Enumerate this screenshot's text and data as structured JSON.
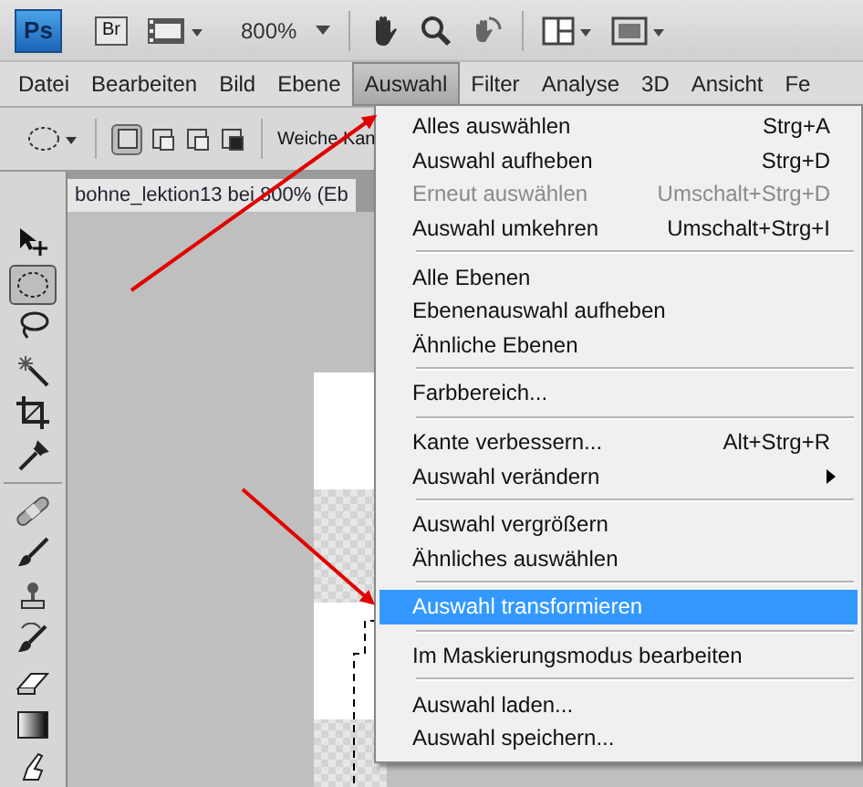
{
  "app_bar": {
    "logo": "Ps",
    "bridge": "Br",
    "zoom": "800%"
  },
  "menu_bar": [
    {
      "label": "Datei",
      "selected": false
    },
    {
      "label": "Bearbeiten",
      "selected": false
    },
    {
      "label": "Bild",
      "selected": false
    },
    {
      "label": "Ebene",
      "selected": false
    },
    {
      "label": "Auswahl",
      "selected": true
    },
    {
      "label": "Filter",
      "selected": false
    },
    {
      "label": "Analyse",
      "selected": false
    },
    {
      "label": "3D",
      "selected": false
    },
    {
      "label": "Ansicht",
      "selected": false
    },
    {
      "label": "Fe",
      "selected": false
    }
  ],
  "options_bar": {
    "modes": [
      {
        "selected": true
      },
      {
        "selected": false
      },
      {
        "selected": false
      },
      {
        "selected": false
      }
    ],
    "feather_label": "Weiche Kan"
  },
  "tools": [
    {
      "kind": "move",
      "selected": false
    },
    {
      "kind": "ellipse",
      "selected": true
    },
    {
      "kind": "lasso",
      "selected": false
    },
    {
      "kind": "wand",
      "selected": false
    },
    {
      "kind": "crop",
      "selected": false
    },
    {
      "kind": "eyedropper",
      "selected": false
    },
    {
      "kind": "separator"
    },
    {
      "kind": "healing",
      "selected": false
    },
    {
      "kind": "brush",
      "selected": false
    },
    {
      "kind": "stamp",
      "selected": false
    },
    {
      "kind": "history",
      "selected": false
    },
    {
      "kind": "eraser",
      "selected": false
    },
    {
      "kind": "gradient",
      "selected": false
    },
    {
      "kind": "finger",
      "selected": false
    }
  ],
  "document_tab": {
    "title": "bohne_lektion13 bei 800% (Eb"
  },
  "menu": [
    {
      "kind": "item",
      "label": "Alles auswählen",
      "shortcut": "Strg+A",
      "disabled": false,
      "selected": false,
      "submenu": false
    },
    {
      "kind": "item",
      "label": "Auswahl aufheben",
      "shortcut": "Strg+D",
      "disabled": false,
      "selected": false,
      "submenu": false
    },
    {
      "kind": "item",
      "label": "Erneut auswählen",
      "shortcut": "Umschalt+Strg+D",
      "disabled": true,
      "selected": false,
      "submenu": false
    },
    {
      "kind": "item",
      "label": "Auswahl umkehren",
      "shortcut": "Umschalt+Strg+I",
      "disabled": false,
      "selected": false,
      "submenu": false
    },
    {
      "kind": "separator"
    },
    {
      "kind": "item",
      "label": "Alle Ebenen",
      "disabled": false,
      "selected": false,
      "submenu": false
    },
    {
      "kind": "item",
      "label": "Ebenenauswahl aufheben",
      "disabled": false,
      "selected": false,
      "submenu": false
    },
    {
      "kind": "item",
      "label": "Ähnliche Ebenen",
      "disabled": false,
      "selected": false,
      "submenu": false
    },
    {
      "kind": "separator"
    },
    {
      "kind": "item",
      "label": "Farbbereich...",
      "disabled": false,
      "selected": false,
      "submenu": false
    },
    {
      "kind": "separator"
    },
    {
      "kind": "item",
      "label": "Kante verbessern...",
      "shortcut": "Alt+Strg+R",
      "disabled": false,
      "selected": false,
      "submenu": false
    },
    {
      "kind": "item",
      "label": "Auswahl verändern",
      "disabled": false,
      "selected": false,
      "submenu": true
    },
    {
      "kind": "separator"
    },
    {
      "kind": "item",
      "label": "Auswahl vergrößern",
      "disabled": false,
      "selected": false,
      "submenu": false
    },
    {
      "kind": "item",
      "label": "Ähnliches auswählen",
      "disabled": false,
      "selected": false,
      "submenu": false
    },
    {
      "kind": "separator"
    },
    {
      "kind": "item",
      "label": "Auswahl transformieren",
      "disabled": false,
      "selected": true,
      "submenu": false
    },
    {
      "kind": "separator"
    },
    {
      "kind": "item",
      "label": "Im Maskierungsmodus bearbeiten",
      "disabled": false,
      "selected": false,
      "submenu": false
    },
    {
      "kind": "separator"
    },
    {
      "kind": "item",
      "label": "Auswahl laden...",
      "disabled": false,
      "selected": false,
      "submenu": false
    },
    {
      "kind": "item",
      "label": "Auswahl speichern...",
      "disabled": false,
      "selected": false,
      "submenu": false
    }
  ]
}
